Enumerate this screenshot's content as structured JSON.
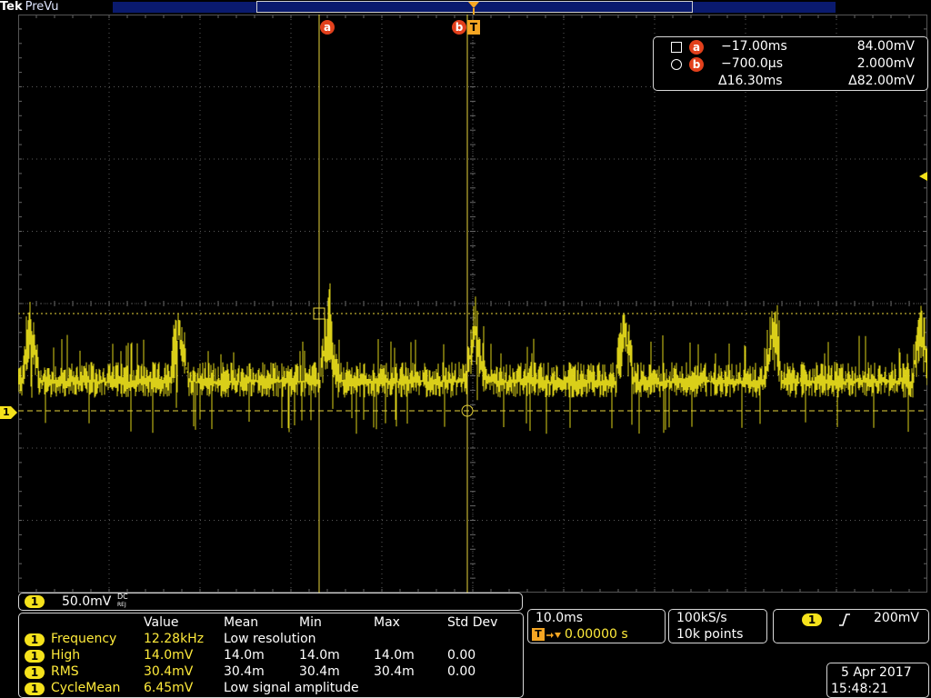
{
  "header": {
    "brand": "Tek",
    "mode": "PreVu"
  },
  "markers": {
    "cursor_a": "a",
    "cursor_b": "b",
    "trigger": "T",
    "channel": "1"
  },
  "cursor_readout": {
    "a_time": "−17.00ms",
    "a_volt": "84.00mV",
    "b_time": "−700.0µs",
    "b_volt": "2.000mV",
    "delta_time": "Δ16.30ms",
    "delta_volt": "Δ82.00mV"
  },
  "channel_scale": {
    "channel": "1",
    "volts_per_div": "50.0mV",
    "coupling_top": "DC",
    "coupling_bottom": "REJ"
  },
  "measurements": {
    "headers": [
      "Value",
      "Mean",
      "Min",
      "Max",
      "Std Dev"
    ],
    "rows": [
      {
        "ch": "1",
        "name": "Frequency",
        "value": "12.28kHz",
        "mean": "Low resolution",
        "min": "",
        "max": "",
        "std": ""
      },
      {
        "ch": "1",
        "name": "High",
        "value": "14.0mV",
        "mean": "14.0m",
        "min": "14.0m",
        "max": "14.0m",
        "std": "0.00"
      },
      {
        "ch": "1",
        "name": "RMS",
        "value": "30.4mV",
        "mean": "30.4m",
        "min": "30.4m",
        "max": "30.4m",
        "std": "0.00"
      },
      {
        "ch": "1",
        "name": "CycleMean",
        "value": "6.45mV",
        "mean": "Low signal amplitude",
        "min": "",
        "max": "",
        "std": ""
      }
    ]
  },
  "timebase": {
    "scale": "10.0ms",
    "position": "0.00000 s"
  },
  "acquisition": {
    "sample_rate": "100kS/s",
    "record_length": "10k points"
  },
  "trigger": {
    "channel": "1",
    "slope_icon": "rising-edge-icon",
    "level": "200mV"
  },
  "timestamp": {
    "date": "5 Apr 2017",
    "time": "15:48:21"
  },
  "colors": {
    "trace": "#f2e51c",
    "cursor": "#e8d43a",
    "cursor_badge": "#e2401c",
    "record_bar": "#0a1a6e"
  }
}
